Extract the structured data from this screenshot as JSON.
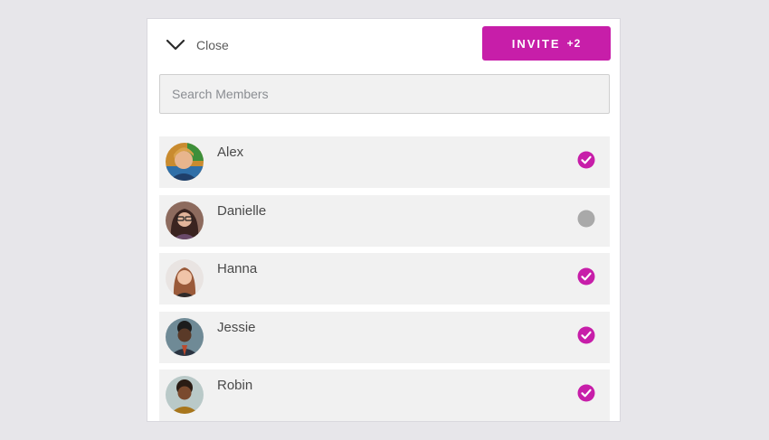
{
  "header": {
    "close_label": "Close",
    "invite_label": "INVITE",
    "invite_count": "+2"
  },
  "search": {
    "placeholder": "Search Members",
    "value": ""
  },
  "colors": {
    "accent": "#c71ea9",
    "unselected": "#a9a9a9",
    "row_bg": "#f1f1f1"
  },
  "members": [
    {
      "name": "Alex",
      "selected": true,
      "avatar_icon": "person-photo-icon"
    },
    {
      "name": "Danielle",
      "selected": false,
      "avatar_icon": "person-photo-icon"
    },
    {
      "name": "Hanna",
      "selected": true,
      "avatar_icon": "person-photo-icon"
    },
    {
      "name": "Jessie",
      "selected": true,
      "avatar_icon": "person-photo-icon"
    },
    {
      "name": "Robin",
      "selected": true,
      "avatar_icon": "person-photo-icon"
    }
  ]
}
